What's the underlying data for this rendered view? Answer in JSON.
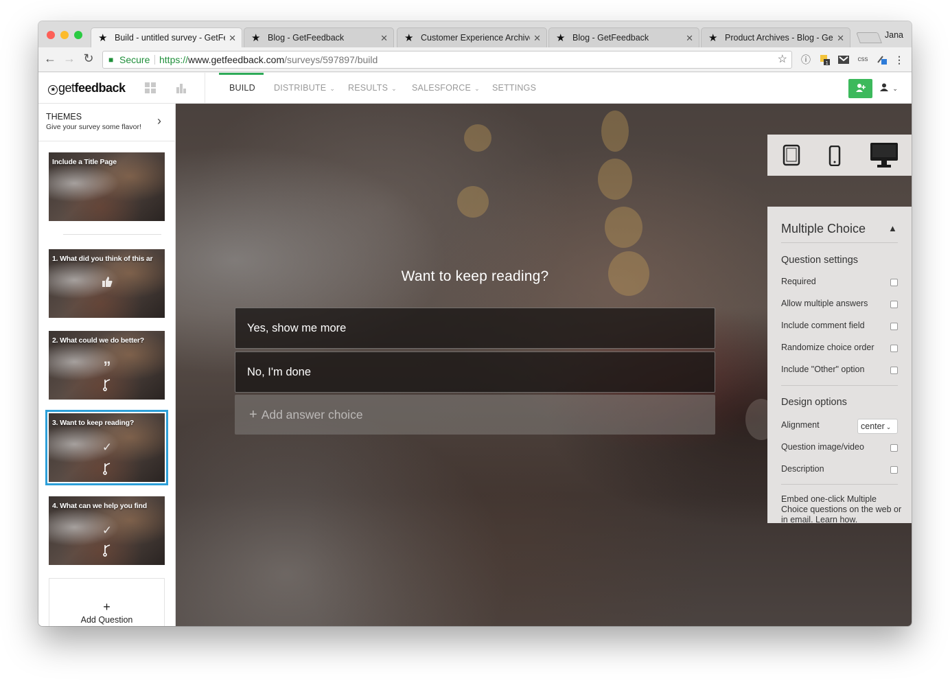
{
  "browser": {
    "tabs": [
      {
        "title": "Build - untitled survey - GetFeedback",
        "active": true
      },
      {
        "title": "Blog - GetFeedback",
        "active": false
      },
      {
        "title": "Customer Experience Archives - Blog",
        "active": false
      },
      {
        "title": "Blog - GetFeedback",
        "active": false
      },
      {
        "title": "Product Archives - Blog - GetFeedback",
        "active": false
      }
    ],
    "profile_name": "Jana",
    "secure_label": "Secure",
    "url_scheme": "https://",
    "url_host": "www.getfeedback.com",
    "url_path": "/surveys/597897/build",
    "traffic_lights": [
      "#fd5f57",
      "#fcbb2d",
      "#2acb42"
    ],
    "extension_icons": [
      "1password-icon",
      "notes-extension-icon",
      "gmail-extension-icon",
      "css-extension-icon",
      "color-picker-extension-icon",
      "menu-icon"
    ],
    "extension_labels": {
      "css": "css"
    }
  },
  "app": {
    "logo_prefix": "get",
    "logo_suffix": "feedback",
    "nav": {
      "build": "BUILD",
      "distribute": "DISTRIBUTE",
      "results": "RESULTS",
      "salesforce": "SALESFORCE",
      "settings": "SETTINGS"
    },
    "accent_color": "#3cb95c",
    "selected_color": "#2d9fd8"
  },
  "sidebar": {
    "themes_title": "THEMES",
    "themes_subtitle": "Give your survey some flavor!",
    "pages": [
      {
        "label": "Include a Title Page",
        "icons": []
      },
      {
        "label": "1. What did you think of this ar",
        "icons": [
          "thumbs-up-icon"
        ]
      },
      {
        "label": "2. What could we do better?",
        "icons": [
          "quote-icon",
          "branch-logic-icon"
        ]
      },
      {
        "label": "3. Want to keep reading?",
        "icons": [
          "checkmark-icon",
          "branch-logic-icon"
        ],
        "selected": true
      },
      {
        "label": "4. What can we help you find",
        "icons": [
          "checkmark-icon",
          "branch-logic-icon"
        ]
      }
    ],
    "add_question_label": "Add Question"
  },
  "canvas": {
    "question": "Want to keep reading?",
    "choices": [
      "Yes, show me more",
      "No, I'm done"
    ],
    "add_choice_label": "Add answer choice"
  },
  "devices": {
    "tablet": "tablet-icon",
    "phone": "phone-icon",
    "desktop": "desktop-icon",
    "selected": "desktop"
  },
  "panel": {
    "title": "Multiple Choice",
    "question_settings_title": "Question settings",
    "options": [
      {
        "label": "Required",
        "checked": false
      },
      {
        "label": "Allow multiple answers",
        "checked": false
      },
      {
        "label": "Include comment field",
        "checked": false
      },
      {
        "label": "Randomize choice order",
        "checked": false
      },
      {
        "label": "Include \"Other\" option",
        "checked": false
      }
    ],
    "design_title": "Design options",
    "alignment_label": "Alignment",
    "alignment_value": "center",
    "design_options": [
      {
        "label": "Question image/video",
        "checked": false
      },
      {
        "label": "Description",
        "checked": false
      }
    ],
    "embed_text": "Embed one-click Multiple Choice questions on the web or in email. Learn how."
  }
}
